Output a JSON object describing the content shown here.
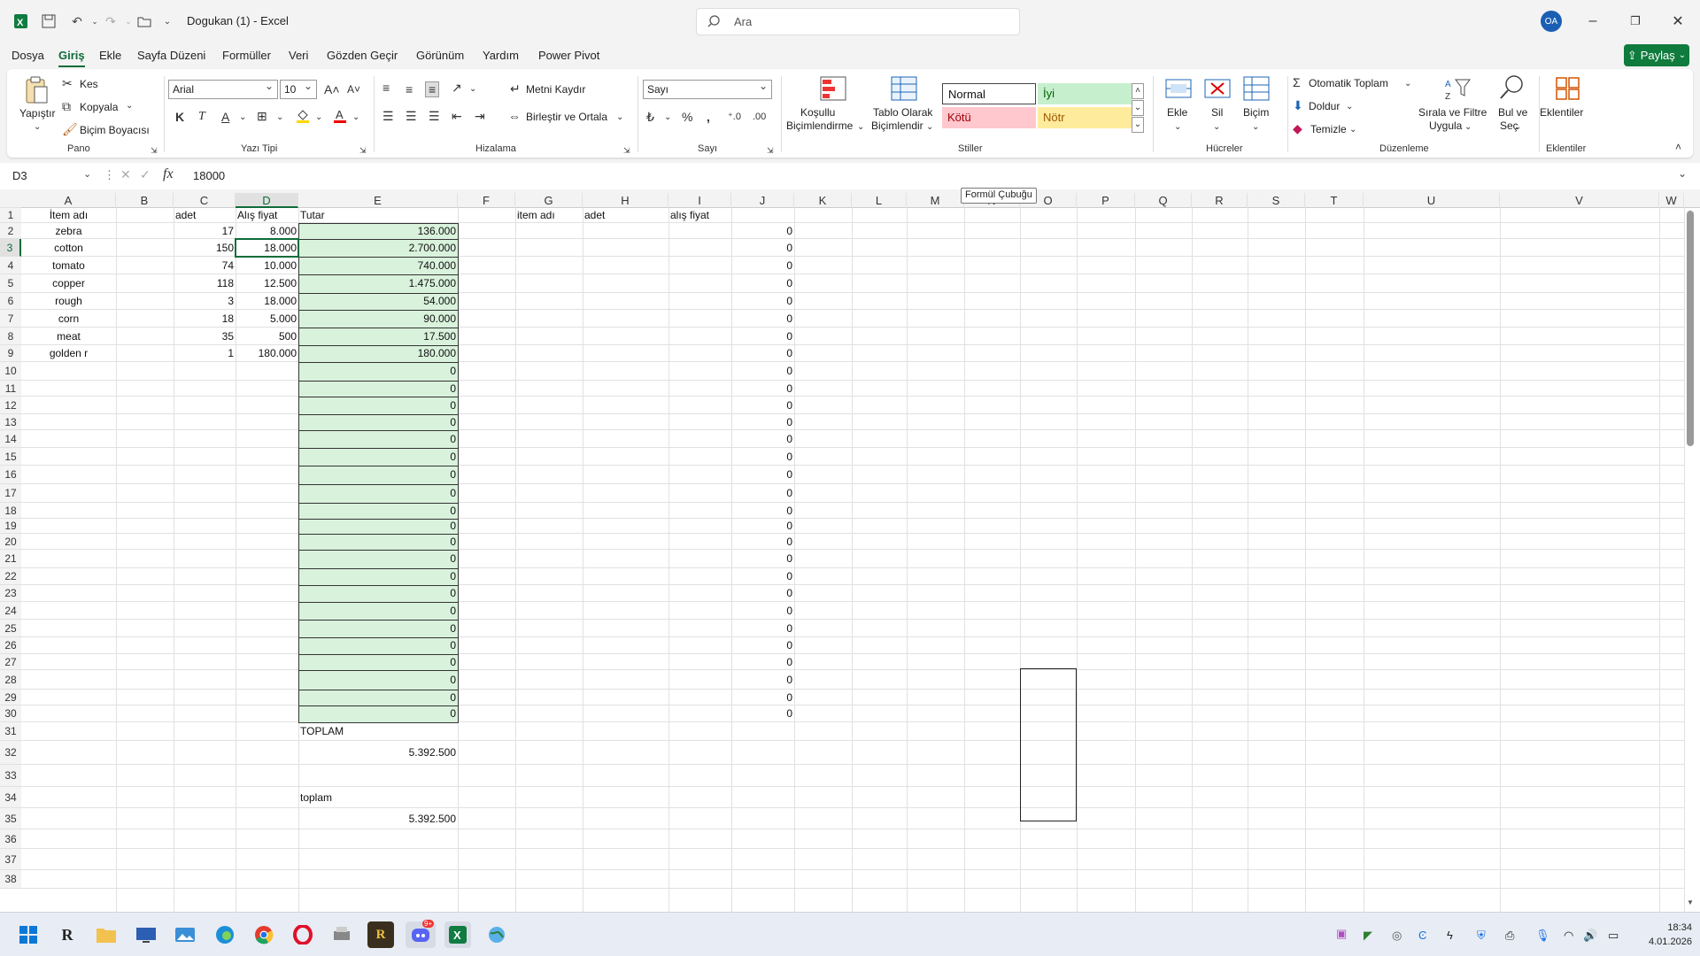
{
  "window": {
    "title": "Dogukan (1)  -  Excel",
    "search_placeholder": "Ara",
    "user_initials": "OA"
  },
  "tabs": [
    "Dosya",
    "Giriş",
    "Ekle",
    "Sayfa Düzeni",
    "Formüller",
    "Veri",
    "Gözden Geçir",
    "Görünüm",
    "Yardım",
    "Power Pivot"
  ],
  "share_label": "Paylaş",
  "ribbon": {
    "pano": {
      "label": "Pano",
      "paste": "Yapıştır",
      "cut": "Kes",
      "copy": "Kopyala",
      "format_painter": "Biçim Boyacısı"
    },
    "yazi_tipi": {
      "label": "Yazı Tipi",
      "font": "Arial",
      "size": "10",
      "bold": "K",
      "italic": "T",
      "underline": "A"
    },
    "hizalama": {
      "label": "Hizalama",
      "wrap": "Metni Kaydır",
      "merge": "Birleştir ve Ortala"
    },
    "sayi": {
      "label": "Sayı",
      "format": "Sayı"
    },
    "stiller": {
      "label": "Stiller",
      "conditional": [
        "Koşullu",
        "Biçimlendirme"
      ],
      "table": [
        "Tablo Olarak",
        "Biçimlendir"
      ],
      "normal": "Normal",
      "good": "İyi",
      "bad": "Kötü",
      "neutral": "Nötr"
    },
    "hucreler": {
      "label": "Hücreler",
      "insert": "Ekle",
      "delete": "Sil",
      "format": "Biçim"
    },
    "duzenleme": {
      "label": "Düzenleme",
      "autosum": "Otomatik Toplam",
      "fill": "Doldur",
      "clear": "Temizle",
      "sort": [
        "Sırala ve Filtre",
        "Uygula"
      ],
      "find": [
        "Bul ve",
        "Seç"
      ]
    },
    "eklentiler": {
      "label": "Eklentiler",
      "addins": "Eklentiler"
    }
  },
  "formula_bar": {
    "name_box": "D3",
    "value": "18000",
    "tooltip": "Formül Çubuğu"
  },
  "columns": [
    "A",
    "B",
    "C",
    "D",
    "E",
    "F",
    "G",
    "H",
    "I",
    "J",
    "K",
    "L",
    "M",
    "N",
    "O",
    "P",
    "Q",
    "R",
    "S",
    "T",
    "U",
    "V",
    "W"
  ],
  "rows": [
    "1",
    "2",
    "3",
    "4",
    "5",
    "6",
    "7",
    "8",
    "9",
    "10",
    "11",
    "12",
    "13",
    "14",
    "15",
    "16",
    "17",
    "18",
    "19",
    "20",
    "21",
    "22",
    "23",
    "24",
    "25",
    "26",
    "27",
    "28",
    "29",
    "30",
    "31",
    "32",
    "33",
    "34",
    "35",
    "36",
    "37",
    "38"
  ],
  "sheet": {
    "headers": {
      "a": "İtem adı",
      "c": "adet",
      "d": "Alış fiyat",
      "e": "Tutar",
      "g": "item adı",
      "h": "adet",
      "i": "alış fiyat"
    },
    "items": [
      {
        "name": "zebra",
        "qty": "17",
        "price": "8.000",
        "total": "136.000"
      },
      {
        "name": "cotton",
        "qty": "150",
        "price": "18.000",
        "total": "2.700.000"
      },
      {
        "name": "tomato",
        "qty": "74",
        "price": "10.000",
        "total": "740.000"
      },
      {
        "name": "copper",
        "qty": "118",
        "price": "12.500",
        "total": "1.475.000"
      },
      {
        "name": "rough",
        "qty": "3",
        "price": "18.000",
        "total": "54.000"
      },
      {
        "name": "corn",
        "qty": "18",
        "price": "5.000",
        "total": "90.000"
      },
      {
        "name": "meat",
        "qty": "35",
        "price": "500",
        "total": "17.500"
      },
      {
        "name": "golden r",
        "qty": "1",
        "price": "180.000",
        "total": "180.000"
      }
    ],
    "zero_value": "0",
    "toplam_label_1": "TOPLAM",
    "toplam_value_1": "5.392.500",
    "toplam_label_2": "toplam",
    "toplam_value_2": "5.392.500"
  },
  "taskbar": {
    "clock_time": "18:34",
    "clock_date": "4.01.2026",
    "discord_badge": "9+"
  }
}
